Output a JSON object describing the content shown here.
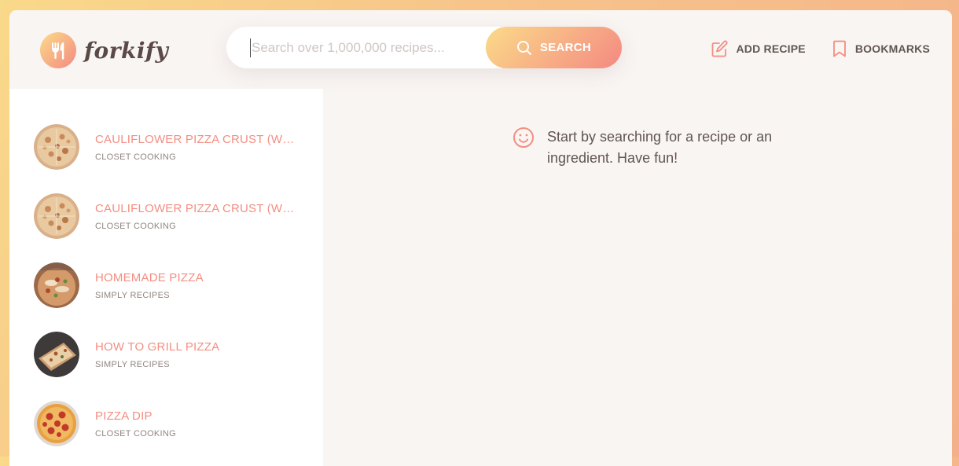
{
  "brand": {
    "name": "forkify",
    "accent_from": "#fbdb89",
    "accent_to": "#f48982"
  },
  "search": {
    "placeholder": "Search over 1,000,000 recipes...",
    "value": "",
    "button_label": "SEARCH"
  },
  "nav": [
    {
      "label": "ADD RECIPE",
      "icon": "edit-icon"
    },
    {
      "label": "BOOKMARKS",
      "icon": "bookmark-icon"
    }
  ],
  "results": [
    {
      "title": "CAULIFLOWER PIZZA CRUST (WITH BBQ CHICKEN PIZZA)",
      "publisher": "CLOSET COOKING",
      "thumb": "pizza-crust"
    },
    {
      "title": "CAULIFLOWER PIZZA CRUST (WITH BBQ CHICKEN PIZZA)",
      "publisher": "CLOSET COOKING",
      "thumb": "pizza-crust"
    },
    {
      "title": "HOMEMADE PIZZA",
      "publisher": "SIMPLY RECIPES",
      "thumb": "homemade-pizza"
    },
    {
      "title": "HOW TO GRILL PIZZA",
      "publisher": "SIMPLY RECIPES",
      "thumb": "grill-pizza"
    },
    {
      "title": "PIZZA DIP",
      "publisher": "CLOSET COOKING",
      "thumb": "pizza-dip"
    }
  ],
  "message": {
    "text": "Start by searching for a recipe or an ingredient. Have fun!",
    "icon": "smile-icon"
  }
}
